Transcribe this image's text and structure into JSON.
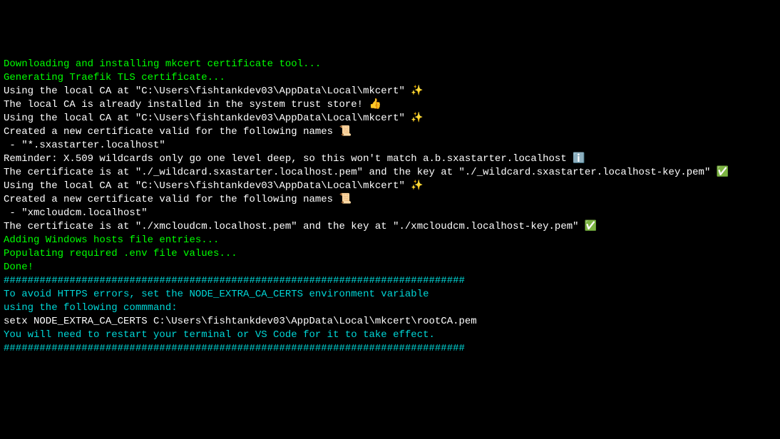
{
  "lines": [
    {
      "color": "green",
      "text": "Downloading and installing mkcert certificate tool..."
    },
    {
      "color": "green",
      "text": "Generating Traefik TLS certificate..."
    },
    {
      "color": "white",
      "text": "Using the local CA at \"C:\\Users\\fishtankdev03\\AppData\\Local\\mkcert\" ✨"
    },
    {
      "color": "white",
      "text": "The local CA is already installed in the system trust store! 👍"
    },
    {
      "color": "white",
      "text": ""
    },
    {
      "color": "white",
      "text": "Using the local CA at \"C:\\Users\\fishtankdev03\\AppData\\Local\\mkcert\" ✨"
    },
    {
      "color": "white",
      "text": ""
    },
    {
      "color": "white",
      "text": "Created a new certificate valid for the following names 📜"
    },
    {
      "color": "white",
      "text": " - \"*.sxastarter.localhost\""
    },
    {
      "color": "white",
      "text": ""
    },
    {
      "color": "white",
      "text": "Reminder: X.509 wildcards only go one level deep, so this won't match a.b.sxastarter.localhost ℹ️"
    },
    {
      "color": "white",
      "text": ""
    },
    {
      "color": "white",
      "text": "The certificate is at \"./_wildcard.sxastarter.localhost.pem\" and the key at \"./_wildcard.sxastarter.localhost-key.pem\" ✅"
    },
    {
      "color": "white",
      "text": ""
    },
    {
      "color": "white",
      "text": "Using the local CA at \"C:\\Users\\fishtankdev03\\AppData\\Local\\mkcert\" ✨"
    },
    {
      "color": "white",
      "text": ""
    },
    {
      "color": "white",
      "text": "Created a new certificate valid for the following names 📜"
    },
    {
      "color": "white",
      "text": " - \"xmcloudcm.localhost\""
    },
    {
      "color": "white",
      "text": ""
    },
    {
      "color": "white",
      "text": "The certificate is at \"./xmcloudcm.localhost.pem\" and the key at \"./xmcloudcm.localhost-key.pem\" ✅"
    },
    {
      "color": "white",
      "text": ""
    },
    {
      "color": "green",
      "text": "Adding Windows hosts file entries..."
    },
    {
      "color": "green",
      "text": "Populating required .env file values..."
    },
    {
      "color": "green",
      "text": "Done!"
    },
    {
      "color": "white",
      "text": ""
    },
    {
      "color": "cyan",
      "text": "#############################################################################"
    },
    {
      "color": "cyan",
      "text": "To avoid HTTPS errors, set the NODE_EXTRA_CA_CERTS environment variable"
    },
    {
      "color": "cyan",
      "text": "using the following commmand:"
    },
    {
      "color": "white",
      "text": "setx NODE_EXTRA_CA_CERTS C:\\Users\\fishtankdev03\\AppData\\Local\\mkcert\\rootCA.pem"
    },
    {
      "color": "cyan",
      "text": ""
    },
    {
      "color": "cyan",
      "text": "You will need to restart your terminal or VS Code for it to take effect."
    },
    {
      "color": "cyan",
      "text": "#############################################################################"
    }
  ]
}
